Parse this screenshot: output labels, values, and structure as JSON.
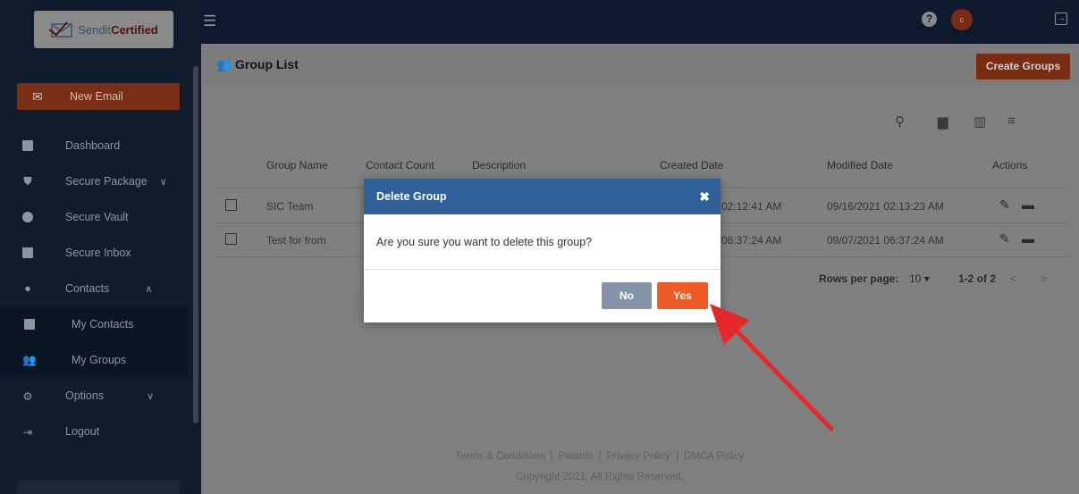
{
  "logo": {
    "part1": "Sendit",
    "part2": "Certified",
    "mark": "®"
  },
  "sidebar": {
    "new_email": "New Email",
    "items": [
      {
        "label": "Dashboard",
        "icon": "dashboard-icon"
      },
      {
        "label": "Secure Package",
        "icon": "shield-icon",
        "chevron": "∨"
      },
      {
        "label": "Secure Vault",
        "icon": "cloud-icon"
      },
      {
        "label": "Secure Inbox",
        "icon": "inbox-icon"
      },
      {
        "label": "Contacts",
        "icon": "person-icon",
        "chevron": "∧"
      },
      {
        "label": "My Contacts",
        "icon": "contact-card-icon"
      },
      {
        "label": "My Groups",
        "icon": "group-icon"
      },
      {
        "label": "Options",
        "icon": "gear-icon",
        "chevron": "∨"
      },
      {
        "label": "Logout",
        "icon": "logout-icon"
      }
    ]
  },
  "topbar": {
    "help": "?",
    "avatar": "c"
  },
  "header": {
    "title": "Group List",
    "create_button": "Create Groups"
  },
  "table": {
    "columns": [
      "Group Name",
      "Contact Count",
      "Description",
      "Created Date",
      "Modified Date",
      "Actions"
    ],
    "rows": [
      {
        "group_name": "SIC Team",
        "created_partial": "02:12:41 AM",
        "modified": "09/16/2021 02:13:23 AM"
      },
      {
        "group_name": "Test for from",
        "created_partial": "06:37:24 AM",
        "modified": "09/07/2021 06:37:24 AM"
      }
    ],
    "pagination": {
      "rows_per_page_label": "Rows per page:",
      "rows_per_page": "10",
      "range": "1-2 of 2"
    }
  },
  "footer": {
    "links": [
      "Terms & Conditions",
      "Patents",
      "Privacy Policy",
      "DMCA Policy"
    ],
    "copyright": "Copyright 2021. All Rights Reserved."
  },
  "modal": {
    "title": "Delete Group",
    "close": "✖",
    "message": "Are you sure you want to delete this group?",
    "no": "No",
    "yes": "Yes"
  },
  "colors": {
    "accent": "#f05a23",
    "modal_header": "#2f6099",
    "annotation_arrow": "#e5282a"
  }
}
